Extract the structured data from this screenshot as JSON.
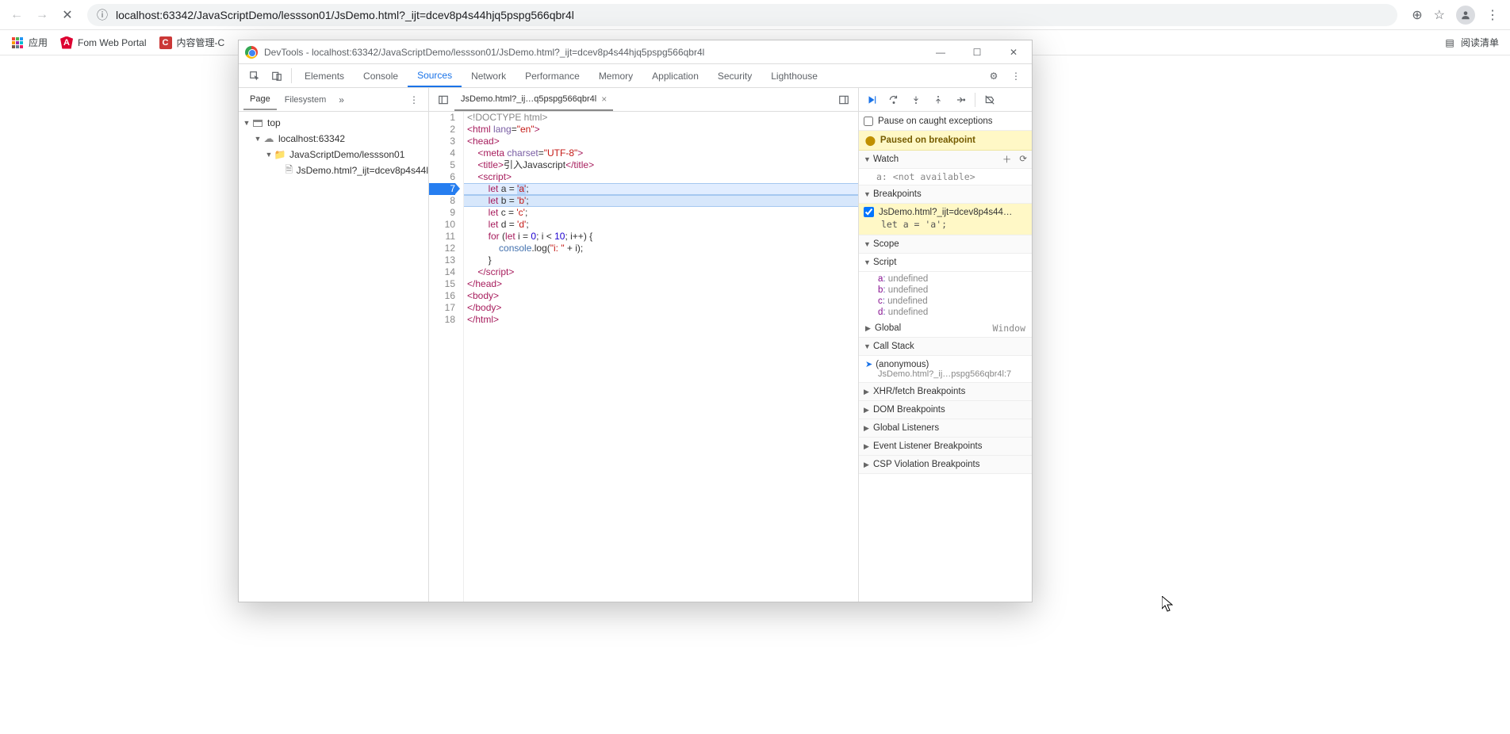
{
  "browser": {
    "url": "localhost:63342/JavaScriptDemo/lessson01/JsDemo.html?_ijt=dcev8p4s44hjq5pspg566qbr4l",
    "bookmarks": {
      "apps": "应用",
      "b1": "Fom Web Portal",
      "b2": "内容管理-C",
      "reading_list": "阅读清单"
    }
  },
  "devtools": {
    "title": "DevTools - localhost:63342/JavaScriptDemo/lessson01/JsDemo.html?_ijt=dcev8p4s44hjq5pspg566qbr4l",
    "tabs": [
      "Elements",
      "Console",
      "Sources",
      "Network",
      "Performance",
      "Memory",
      "Application",
      "Security",
      "Lighthouse"
    ],
    "activeTab": "Sources",
    "nav": {
      "tabs": {
        "page": "Page",
        "filesystem": "Filesystem"
      },
      "tree": {
        "top": "top",
        "host": "localhost:63342",
        "folder": "JavaScriptDemo/lessson01",
        "file": "JsDemo.html?_ijt=dcev8p4s44l"
      }
    },
    "editor": {
      "tabName": "JsDemo.html?_ij…q5pspg566qbr4l",
      "lineNumbers": [
        "1",
        "2",
        "3",
        "4",
        "5",
        "6",
        "7",
        "8",
        "9",
        "10",
        "11",
        "12",
        "13",
        "14",
        "15",
        "16",
        "17",
        "18"
      ]
    },
    "debugger": {
      "pauseOnCaught": "Pause on caught exceptions",
      "pausedBanner": "Paused on breakpoint",
      "watch": {
        "title": "Watch",
        "var": "a: <not available>"
      },
      "breakpoints": {
        "title": "Breakpoints",
        "item": "JsDemo.html?_ijt=dcev8p4s44…",
        "code": "let a = 'a';"
      },
      "scope": {
        "title": "Scope",
        "script": "Script",
        "vars": [
          {
            "n": "a",
            "v": "undefined"
          },
          {
            "n": "b",
            "v": "undefined"
          },
          {
            "n": "c",
            "v": "undefined"
          },
          {
            "n": "d",
            "v": "undefined"
          }
        ],
        "global": "Global",
        "globalVal": "Window"
      },
      "callstack": {
        "title": "Call Stack",
        "fn": "(anonymous)",
        "loc": "JsDemo.html?_ij…pspg566qbr4l:7"
      },
      "sections": {
        "xhr": "XHR/fetch Breakpoints",
        "dom": "DOM Breakpoints",
        "gl": "Global Listeners",
        "el": "Event Listener Breakpoints",
        "csp": "CSP Violation Breakpoints"
      }
    }
  }
}
